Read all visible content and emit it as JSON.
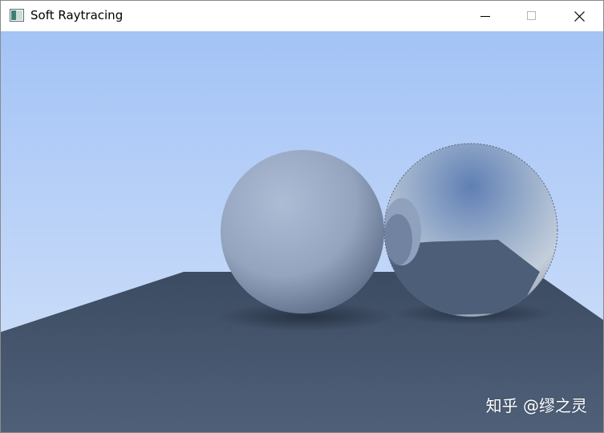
{
  "window": {
    "title": "Soft Raytracing",
    "icon": "app-window-icon",
    "controls": {
      "minimize_icon": "minimize-icon",
      "maximize_icon": "maximize-icon",
      "close_icon": "close-icon"
    }
  },
  "scene": {
    "sky_top_color": "#a3c3f6",
    "sky_horizon_color": "#d4e3f9",
    "ground_color": "#4a5b74",
    "diffuse_sphere_color": "#a6b7d2",
    "metal_sphere_color": "#7f8fa8"
  },
  "watermark": {
    "text": "知乎 @缪之灵"
  }
}
